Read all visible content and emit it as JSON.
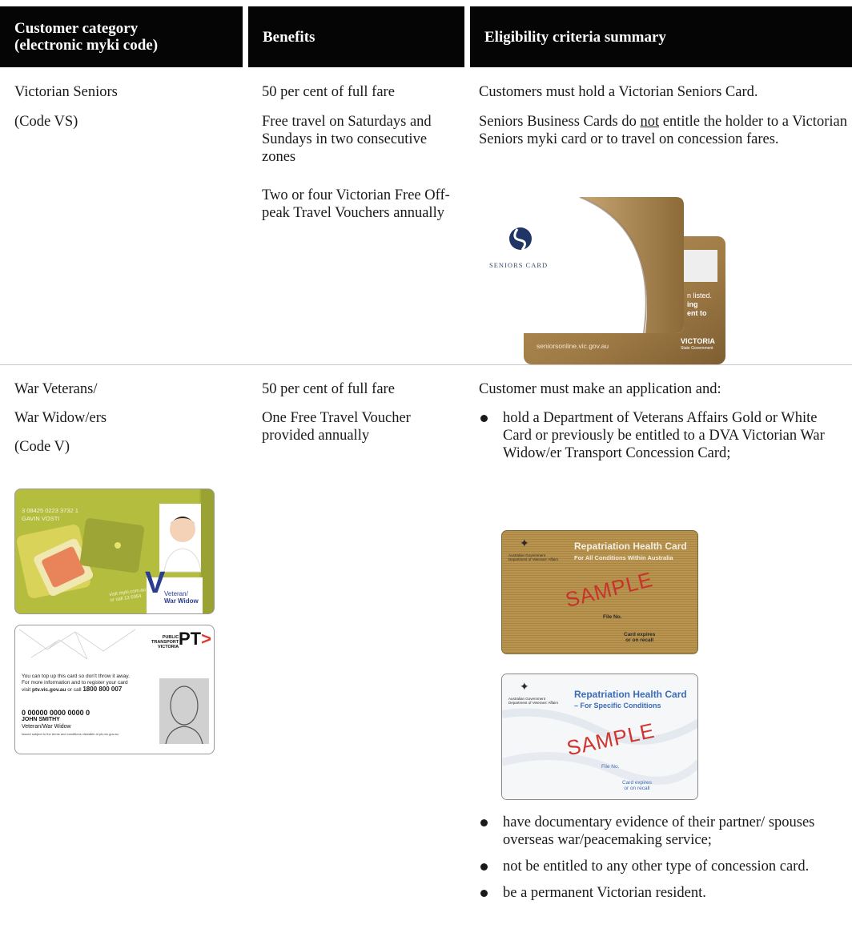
{
  "header": {
    "col1_line1": "Customer category",
    "col1_line2": "(electronic myki code)",
    "col2": "Benefits",
    "col3": "Eligibility criteria summary"
  },
  "rows": [
    {
      "category_lines": [
        "Victorian Seniors",
        "(Code VS)"
      ],
      "benefits": [
        "50 per cent of full fare",
        "Free travel on Saturdays and Sundays in two consecutive zones",
        "Two or four Victorian Free Off-peak Travel Vouchers annually"
      ],
      "eligibility": {
        "line1": "Customers must hold a Victorian Seniors Card.",
        "line2_pre": "Seniors Business Cards do ",
        "line2_underline": "not",
        "line2_post": " entitle the holder to a Victorian Seniors myki card or to travel on concession fares."
      },
      "card_image": {
        "brand": "SENIORS CARD",
        "back_text_1": "n listed.",
        "back_text_2": "ing",
        "back_text_3": "ent to",
        "url": "seniorsonline.vic.gov.au",
        "logo_main": "VICTORIA",
        "logo_sub": "State Government"
      }
    },
    {
      "category_lines": [
        "War Veterans/",
        "War Widow/ers",
        "(Code V)"
      ],
      "benefits": [
        "50 per cent of full fare",
        "One Free Travel Voucher provided annually"
      ],
      "eligibility": {
        "intro": "Customer must make an application and:",
        "bullets": [
          "hold a Department of Veterans Affairs Gold or White Card or previously be entitled to a DVA Victorian War Widow/er Transport Concession Card;",
          "have documentary evidence of their partner/ spouses overseas war/peacemaking service;",
          "not be entitled to any other type of concession card.",
          "be a permanent Victorian resident."
        ]
      },
      "myki_card_1": {
        "number": "3 08425 0223 3732 1",
        "name": "GAVIN VOSTI",
        "letter": "V",
        "type_line1": "Veteran/",
        "type_line2": "War Widow",
        "site": "visit myki.com.au",
        "call": "or call 13 6954"
      },
      "myki_card_2": {
        "brand_line1": "PUBLIC",
        "brand_line2": "TRANSPORT",
        "brand_line3": "VICTORIA",
        "logo": "PT",
        "text1": "You can top up this card so don't throw it away.",
        "text2": "For more information and to register your card",
        "text3_pre": "visit ",
        "text3_url": "ptv.vic.gov.au",
        "text3_mid": " or call ",
        "text3_phone": "1800 800 007",
        "number": "0 00000 0000 0000 0",
        "name": "JOHN SMITHY",
        "category": "Veteran/War Widow",
        "terms": "Issued subject to the terms and conditions viewable at ptv.vic.gov.au"
      },
      "dva_gold": {
        "title": "Repatriation Health Card",
        "subtitle": "For All Conditions Within Australia",
        "gov1": "Australian Government",
        "gov2": "Department of Veterans' Affairs",
        "stamp": "SAMPLE",
        "file": "File No.",
        "expiry1": "Card expires",
        "expiry2": "or on recall"
      },
      "dva_white": {
        "title": "Repatriation Health Card",
        "subtitle": "– For Specific Conditions",
        "gov1": "Australian Government",
        "gov2": "Department of Veterans' Affairs",
        "stamp": "SAMPLE",
        "file": "File No.",
        "expiry1": "Card expires",
        "expiry2": "or on recall"
      }
    }
  ],
  "colors": {
    "header_bg": "#050505",
    "seniors_bronze": "#a07d4c",
    "myki_green": "#a8b23a",
    "dva_gold": "#b8944f",
    "pt_red": "#e03a2f"
  }
}
